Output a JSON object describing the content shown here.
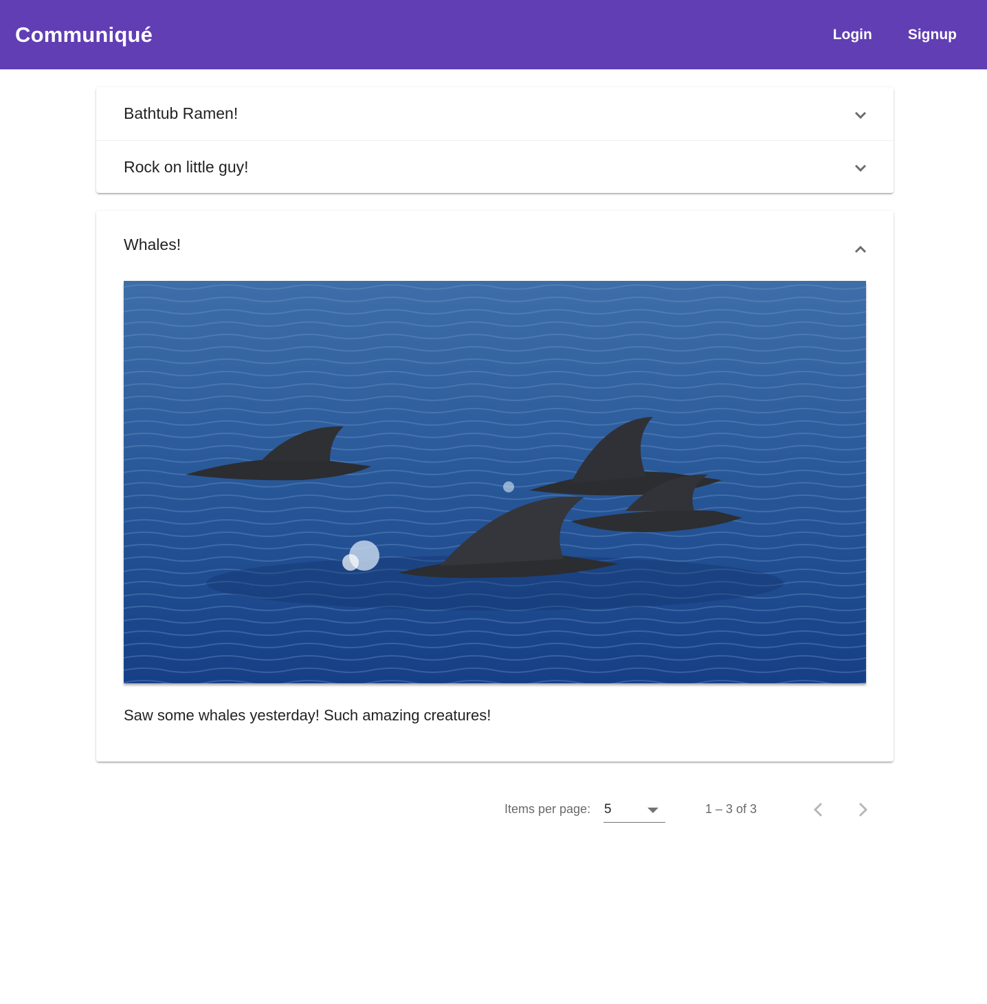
{
  "header": {
    "title": "Communiqué",
    "login_label": "Login",
    "signup_label": "Signup",
    "background_color": "#613eb3"
  },
  "posts": [
    {
      "title": "Bathtub Ramen!",
      "expanded": false,
      "icon": "chevron-down-icon"
    },
    {
      "title": "Rock on little guy!",
      "expanded": false,
      "icon": "chevron-down-icon"
    },
    {
      "title": "Whales!",
      "expanded": true,
      "icon": "chevron-up-icon",
      "image": "whale-fins-photo",
      "body": "Saw some whales yesterday! Such amazing creatures!"
    }
  ],
  "paginator": {
    "items_per_page_label": "Items per page:",
    "items_per_page_value": "5",
    "range_label": "1 – 3 of 3"
  }
}
